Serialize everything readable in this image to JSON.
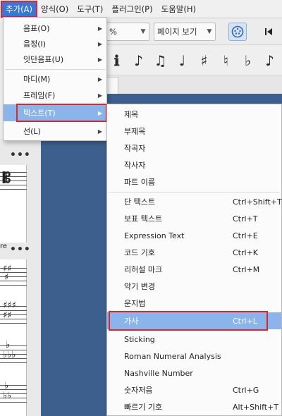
{
  "menubar": {
    "items": [
      "추가(A)",
      "양식(O)",
      "도구(T)",
      "플러그인(P)",
      "도움말(H)"
    ]
  },
  "toolbar": {
    "zoom_value": "%",
    "view_mode": "페이지 보기"
  },
  "note_palette": [
    "ℹ",
    "♪",
    "♫",
    "♩",
    "♯",
    "♮",
    "♭",
    "♪"
  ],
  "add_menu": {
    "items": [
      "음표(O)",
      "음정(I)",
      "잇단음표(U)",
      "마디(M)",
      "프레임(F)",
      "텍스트(T)",
      "선(L)"
    ],
    "selected": "텍스트(T)"
  },
  "text_submenu": {
    "items": [
      {
        "label": "제목",
        "shortcut": ""
      },
      {
        "label": "부제목",
        "shortcut": ""
      },
      {
        "label": "작곡자",
        "shortcut": ""
      },
      {
        "label": "작사자",
        "shortcut": ""
      },
      {
        "label": "파트 이름",
        "shortcut": ""
      },
      {
        "label": "단 텍스트",
        "shortcut": "Ctrl+Shift+T"
      },
      {
        "label": "보표 텍스트",
        "shortcut": "Ctrl+T"
      },
      {
        "label": "Expression Text",
        "shortcut": "Ctrl+E"
      },
      {
        "label": "코드 기호",
        "shortcut": "Ctrl+K"
      },
      {
        "label": "리허설 마크",
        "shortcut": "Ctrl+M"
      },
      {
        "label": "악기 변경",
        "shortcut": ""
      },
      {
        "label": "운지법",
        "shortcut": ""
      },
      {
        "label": "가사",
        "shortcut": "Ctrl+L"
      },
      {
        "label": "Sticking",
        "shortcut": ""
      },
      {
        "label": "Roman Numeral Analysis",
        "shortcut": ""
      },
      {
        "label": "Nashville Number",
        "shortcut": ""
      },
      {
        "label": "숫자저음",
        "shortcut": "Ctrl+G"
      },
      {
        "label": "빠르기 기호",
        "shortcut": "Alt+Shift+T"
      }
    ],
    "selected": "가사"
  },
  "left_panel": {
    "dots": "•••",
    "clef": "𝄡",
    "re_text": "re"
  },
  "colors": {
    "menu_selected": "#8ab4ea",
    "highlight_box": "#e0242c",
    "canvas": "#3c5f8e",
    "menubar_active": "#3a76d8"
  }
}
